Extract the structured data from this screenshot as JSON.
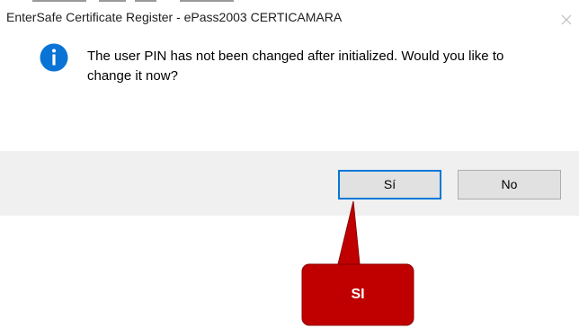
{
  "dialog": {
    "title": "EnterSafe Certificate Register - ePass2003 CERTICAMARA",
    "message_line1": "The user PIN has not been changed after initialized. Would you like to",
    "message_line2": "change it now?",
    "icon": "info-icon",
    "close_icon": "close-icon"
  },
  "buttons": {
    "yes_label": "Sí",
    "no_label": "No"
  },
  "callout": {
    "label": "SI",
    "color": "#c00000"
  },
  "colors": {
    "focus_border": "#0078d7",
    "info_icon": "#0a74d6",
    "button_bar": "#f0f0f0"
  }
}
